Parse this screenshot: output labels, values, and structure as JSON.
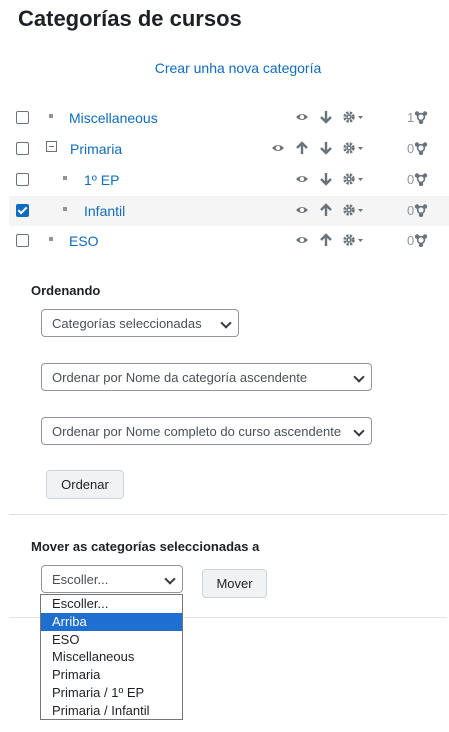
{
  "page": {
    "title": "Categorías de cursos",
    "create_link": "Crear unha nova categoría"
  },
  "categories": [
    {
      "name": "Miscellaneous",
      "count": "1",
      "checked": false
    },
    {
      "name": "Primaria",
      "count": "0",
      "checked": false
    },
    {
      "name": "1º EP",
      "count": "0",
      "checked": false
    },
    {
      "name": "Infantil",
      "count": "0",
      "checked": true
    },
    {
      "name": "ESO",
      "count": "0",
      "checked": false
    }
  ],
  "sort": {
    "heading": "Ordenando",
    "scope_value": "Categorías seleccionadas",
    "category_sort_value": "Ordenar por Nome da categoría ascendente",
    "course_sort_value": "Ordenar por Nome completo do curso ascendente",
    "button": "Ordenar"
  },
  "move": {
    "heading": "Mover as categorías seleccionadas a",
    "select_value": "Escoller...",
    "button": "Mover",
    "options": [
      "Escoller...",
      "Arriba",
      "ESO",
      "Miscellaneous",
      "Primaria",
      "Primaria / 1º EP",
      "Primaria / Infantil"
    ],
    "highlighted": "Arriba"
  },
  "colors": {
    "link": "#0f6cbf",
    "icon": "#6a737b",
    "highlight": "#1e6fcf"
  }
}
